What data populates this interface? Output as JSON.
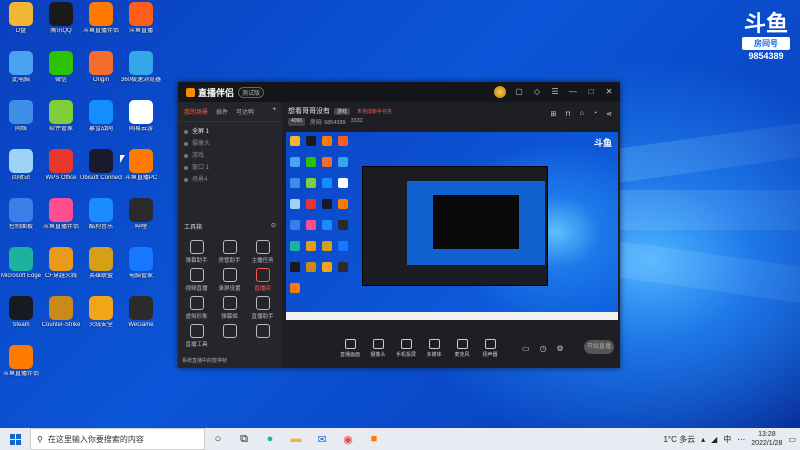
{
  "desktop": {
    "icons": [
      {
        "label": "D盘",
        "icon": "folder-icon",
        "color": "#f2b632"
      },
      {
        "label": "腾讯QQ",
        "icon": "qq-icon",
        "color": "#1a1a1a"
      },
      {
        "label": "斗鱼直播伴侣",
        "icon": "douyu-icon",
        "color": "#ff7a00"
      },
      {
        "label": "斗鱼直播",
        "icon": "douyu-live-icon",
        "color": "#ff5e1a"
      },
      {
        "label": "此电脑",
        "icon": "computer-icon",
        "color": "#4aa3f0"
      },
      {
        "label": "微信",
        "icon": "wechat-icon",
        "color": "#2dc100"
      },
      {
        "label": "Origin",
        "icon": "origin-icon",
        "color": "#f56c2d"
      },
      {
        "label": "360极速浏览器",
        "icon": "browser-icon",
        "color": "#33a7e8"
      },
      {
        "label": "网络",
        "icon": "network-icon",
        "color": "#3d8ee6"
      },
      {
        "label": "软件管家",
        "icon": "software-manager-icon",
        "color": "#7fcf3a"
      },
      {
        "label": "暴雪战网",
        "icon": "battlenet-icon",
        "color": "#148eff"
      },
      {
        "label": "网易云游",
        "icon": "cloud-game-icon",
        "color": "#ffffff"
      },
      {
        "label": "回收站",
        "icon": "recycle-bin-icon",
        "color": "#9fd3f5"
      },
      {
        "label": "WPS Office",
        "icon": "wps-icon",
        "color": "#e8362c"
      },
      {
        "label": "Ubisoft Connect",
        "icon": "ubisoft-icon",
        "color": "#1a1a2e"
      },
      {
        "label": "斗鱼直播PC",
        "icon": "douyu-pc-icon",
        "color": "#ff7a00"
      },
      {
        "label": "控制面板",
        "icon": "control-panel-icon",
        "color": "#3a7ee8"
      },
      {
        "label": "斗鱼直播伴侣",
        "icon": "douyu-companion-icon",
        "color": "#ff4d8d"
      },
      {
        "label": "酷狗音乐",
        "icon": "kugou-icon",
        "color": "#1a8cff"
      },
      {
        "label": "哔哩",
        "icon": "bilibili-icon",
        "color": "#2a2a2a"
      },
      {
        "label": "Microsoft Edge",
        "icon": "edge-icon",
        "color": "#1bb3a0"
      },
      {
        "label": "CF穿越火线",
        "icon": "cf-icon",
        "color": "#e89a1a"
      },
      {
        "label": "英雄联盟",
        "icon": "lol-icon",
        "color": "#d4a017"
      },
      {
        "label": "电脑管家",
        "icon": "pc-manager-icon",
        "color": "#1677ff"
      },
      {
        "label": "Steam",
        "icon": "steam-icon",
        "color": "#171a21"
      },
      {
        "label": "Counter-Strike",
        "icon": "csgo-icon",
        "color": "#c98a1a"
      },
      {
        "label": "火绒安全",
        "icon": "huorong-icon",
        "color": "#f2a516"
      },
      {
        "label": "WeGame",
        "icon": "wegame-icon",
        "color": "#2b2b2b"
      },
      {
        "label": "斗鱼直播伴侣",
        "icon": "douyu-icon-2",
        "color": "#ff7a00"
      }
    ],
    "brand": {
      "logo": "斗鱼",
      "tag": "房间号",
      "room": "9854389"
    }
  },
  "app": {
    "title": "直播伴侣",
    "version": "测试版",
    "left_tabs": [
      "我的场景",
      "插件",
      "可达鸭"
    ],
    "scenes": [
      "全屏 1",
      "摄像头",
      "游戏",
      "窗口 1",
      "场景4"
    ],
    "tools_header": "工具箱",
    "tools": [
      {
        "label": "弹幕助手",
        "highlight": false
      },
      {
        "label": "房管助手",
        "highlight": false
      },
      {
        "label": "主播任务",
        "highlight": false
      },
      {
        "label": "视频直播",
        "highlight": false
      },
      {
        "label": "录屏设置",
        "highlight": false
      },
      {
        "label": "直播间",
        "highlight": true
      },
      {
        "label": "虚拟形象",
        "highlight": false
      },
      {
        "label": "弹幕姬",
        "highlight": false
      },
      {
        "label": "直播助手",
        "highlight": false
      },
      {
        "label": "直播工具",
        "highlight": false
      },
      {
        "label": "",
        "highlight": false
      },
      {
        "label": "",
        "highlight": false
      }
    ],
    "status_text": "系统直播中的暂停帧",
    "main_title": "想看哥哥没有",
    "main_tag": "游戏",
    "main_warning": "未完成新手任务",
    "main_info": [
      "4096",
      "房间: 9854389",
      "3332"
    ],
    "controls": [
      "直播画面",
      "摄像头",
      "手机投屏",
      "多媒体",
      "麦克风",
      "扬声器"
    ],
    "start_label": "开始直播"
  },
  "taskbar": {
    "search_placeholder": "在这里输入你要搜索的内容",
    "weather": "1°C 多云",
    "time": "13:28",
    "date": "2022/1/28"
  }
}
